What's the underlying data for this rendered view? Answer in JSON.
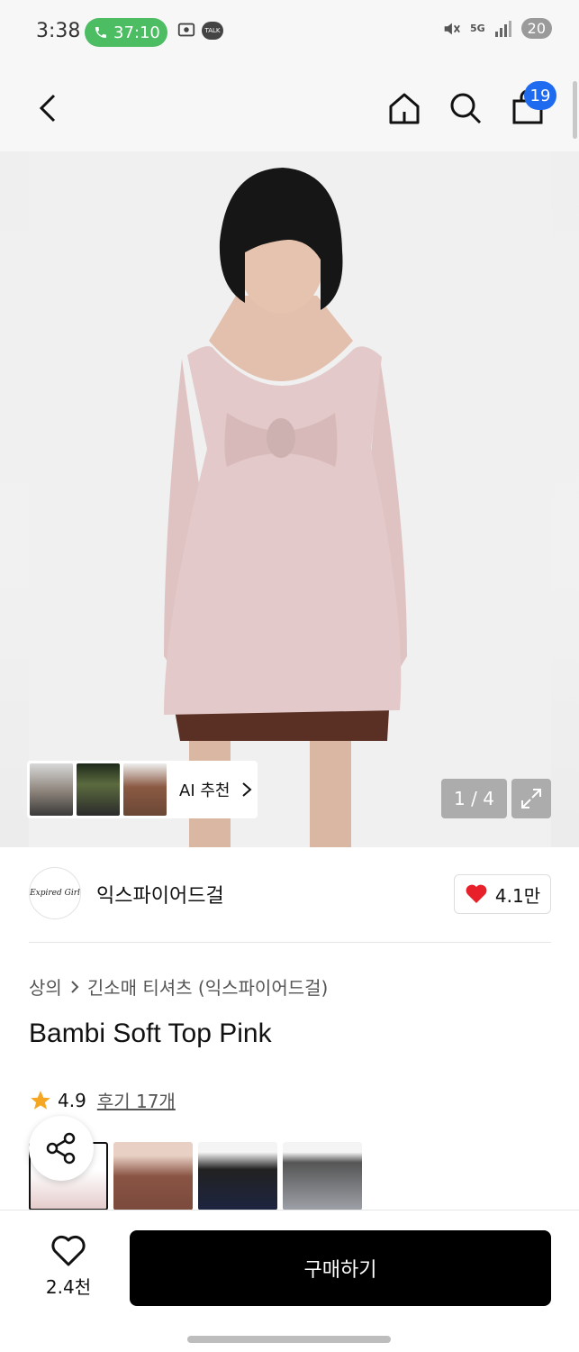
{
  "status": {
    "time": "3:38",
    "call_time": "37:10",
    "talk": "TALK",
    "network": "5G",
    "battery": "20"
  },
  "nav": {
    "cart_count": "19"
  },
  "image": {
    "ai_label": "AI 추천",
    "counter": "1 / 4"
  },
  "brand": {
    "logo_text": "Expired Girl",
    "name": "익스파이어드걸",
    "likes": "4.1만"
  },
  "breadcrumb": {
    "category": "상의",
    "subcategory": "긴소매 티셔츠 (익스파이어드걸)"
  },
  "product": {
    "title": "Bambi Soft Top Pink",
    "rating": "4.9",
    "reviews": "후기 17개"
  },
  "bottom": {
    "wish_count": "2.4천",
    "buy_label": "구매하기"
  },
  "colors": {
    "accent_blue": "#1f6bf0",
    "call_green": "#4cbd62",
    "heart_red": "#e8202a",
    "star_orange": "#f5a623"
  }
}
